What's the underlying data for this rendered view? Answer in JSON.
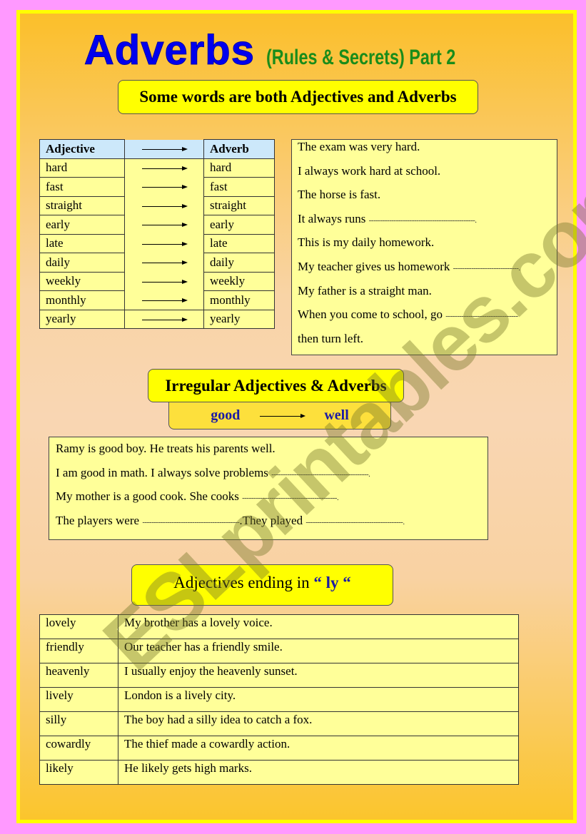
{
  "title": {
    "main": "Adverbs",
    "sub": "(Rules & Secrets) Part 2"
  },
  "section1": {
    "banner": "Some words are both Adjectives and Adverbs",
    "table": {
      "headers": [
        "Adjective",
        "Adverb"
      ],
      "rows": [
        [
          "hard",
          "hard"
        ],
        [
          "fast",
          "fast"
        ],
        [
          "straight",
          "straight"
        ],
        [
          "early",
          "early"
        ],
        [
          "late",
          "late"
        ],
        [
          "daily",
          "daily"
        ],
        [
          "weekly",
          "weekly"
        ],
        [
          "monthly",
          "monthly"
        ],
        [
          "yearly",
          "yearly"
        ]
      ]
    },
    "examples": [
      {
        "text": "The exam was very hard.",
        "blank": ""
      },
      {
        "text": " I always work hard at school.",
        "blank": ""
      },
      {
        "text": "The horse is fast.",
        "blank": ""
      },
      {
        "text": "It always runs ",
        "blank": "-----------------------------------------------."
      },
      {
        "text": "This is my daily homework.",
        "blank": ""
      },
      {
        "text": "My teacher gives us homework ",
        "blank": "-----------------------------."
      },
      {
        "text": "My father is a straight man.",
        "blank": ""
      },
      {
        "text": "When you come to school, go ",
        "blank": "--------------------------------"
      },
      {
        "text": "then turn left.",
        "blank": ""
      }
    ]
  },
  "section2": {
    "banner": "Irregular Adjectives & Adverbs",
    "pair": {
      "adjective": "good",
      "adverb": "well"
    },
    "examples": [
      {
        "parts": [
          "Ramy is good boy. He treats his parents well."
        ]
      },
      {
        "parts": [
          "I am good in math. I always solve problems ",
          "-------------------------------------------."
        ]
      },
      {
        "parts": [
          "My mother is a good cook. She cooks ",
          "------------------------------------------."
        ]
      },
      {
        "parts": [
          "The players were ",
          "-------------------------------------------",
          ".They played ",
          "-------------------------------------------."
        ]
      }
    ]
  },
  "section3": {
    "banner_prefix": "Adjectives ending in ",
    "banner_highlight": "“ ly “",
    "rows": [
      [
        "lovely",
        "My brother has a lovely voice."
      ],
      [
        "friendly",
        "Our teacher has a friendly smile."
      ],
      [
        "heavenly",
        "I usually enjoy the heavenly sunset."
      ],
      [
        "lively",
        "London is a lively city."
      ],
      [
        "silly",
        "The boy had a silly idea to catch a fox."
      ],
      [
        "cowardly",
        "The thief made a cowardly action."
      ],
      [
        "likely",
        "He likely gets high marks."
      ]
    ]
  },
  "watermark": "ESLprintables.com",
  "colors": {
    "page_border": "#ff99ff",
    "frame_border": "#ffff00",
    "title_blue": "#0000ee",
    "subtitle_green": "#1a8c1a",
    "box_fill": "#ffff99",
    "header_fill": "#cce8fa"
  }
}
